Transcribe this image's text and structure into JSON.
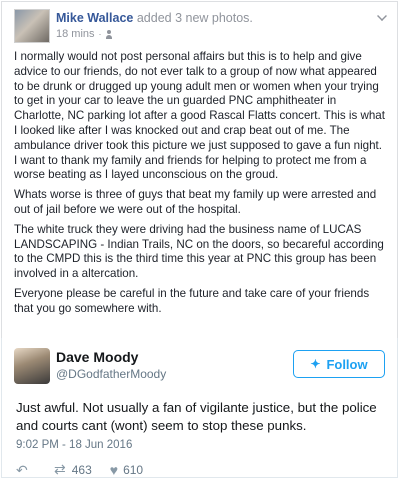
{
  "facebook_post": {
    "author": "Mike Wallace",
    "action": "added 3 new photos.",
    "time": "18 mins",
    "paragraphs": [
      "I normally would not post personal affairs but this is to help and give advice to our friends, do not ever talk to a group of now what appeared to be drunk or drugged up young adult men or women when your trying to get in your car to leave the un guarded PNC amphitheater in Charlotte, NC parking lot after a good Rascal Flatts concert. This is what I looked like after I was knocked out and crap beat out of me. The ambulance driver took this picture we just supposed to gave a fun night. I want to thank my family and friends for helping to protect me from a worse beating as I layed unconscious on the groud.",
      "Whats worse is three of guys that beat my family up were arrested and out of jail before we were out of the hospital.",
      "The white truck they were driving had the business name of LUCAS LANDSCAPING - Indian Trails, NC on the doors, so becareful according to the CMPD this is the third time this year at PNC this group has been involved in a altercation.",
      "Everyone please be careful in the future and take care of your friends that you go somewhere with."
    ]
  },
  "tweet": {
    "name": "Dave Moody",
    "handle": "@DGodfatherMoody",
    "follow_label": "Follow",
    "text": "Just awful. Not usually a fan of vigilante justice, but the police and courts cant (wont) seem to stop these punks.",
    "timestamp": "9:02 PM - 18 Jun 2016",
    "retweets": "463",
    "likes": "610"
  },
  "colors": {
    "facebook_link": "#365899",
    "twitter_blue": "#1da1f2",
    "muted_gray": "#90949c"
  },
  "icons": [
    "friends-icon",
    "chevron-down-icon",
    "twitter-bird-icon",
    "reply-icon",
    "retweet-icon",
    "like-icon"
  ]
}
